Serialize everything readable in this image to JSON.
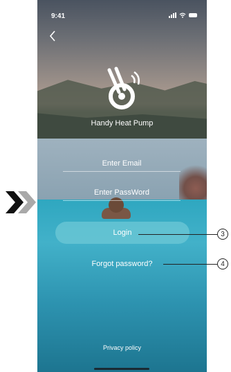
{
  "status_bar": {
    "time": "9:41"
  },
  "app": {
    "name": "Handy Heat Pump"
  },
  "form": {
    "email_placeholder": "Enter Email",
    "password_placeholder": "Enter PassWord",
    "login_label": "Login",
    "forgot_label": "Forgot password?"
  },
  "footer": {
    "privacy_label": "Privacy policy"
  },
  "callouts": {
    "login_number": "3",
    "forgot_number": "4"
  },
  "colors": {
    "login_button": "#6ec8d6",
    "text": "#ffffff"
  },
  "icons": {
    "back": "chevron-left-icon",
    "logo": "heat-pump-logo",
    "signal": "signal-icon",
    "wifi": "wifi-icon",
    "battery": "battery-icon",
    "arrow": "double-chevron-right-icon"
  }
}
